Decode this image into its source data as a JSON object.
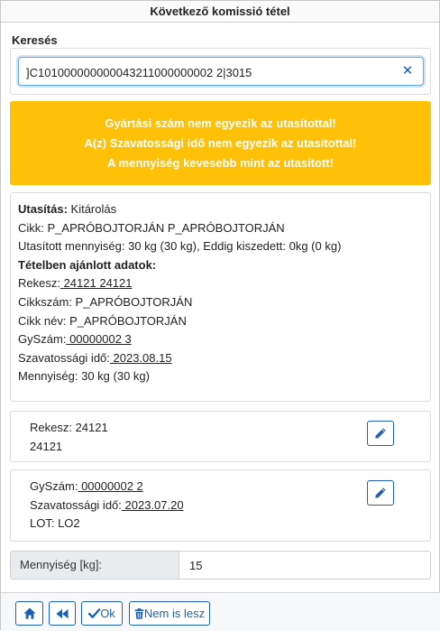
{
  "window": {
    "title": "Következő komissió tétel"
  },
  "search": {
    "label": "Keresés",
    "value": "]C101000000000043211000000002 2|3015",
    "clear_icon": "close-icon"
  },
  "alert": {
    "color": "#ffc107",
    "lines": [
      "Gyártási szám nem egyezik az utasítottal!",
      "A(z) Szavatossági idő nem egyezik az utasítottal!",
      "A mennyiség kevesebb mint az utasított!"
    ]
  },
  "instruction": {
    "label": "Utasítás:",
    "value": " Kitárolás",
    "item_line": " Cikk: P_APRÓBOJTORJÁN P_APRÓBOJTORJÁN",
    "qty_line": " Utasított mennyiség: 30 kg (30 kg), Eddig kiszedett: 0kg (0 kg)",
    "recommended_header": "Tételben ajánlott adatok:",
    "rekesz_label": "Rekesz:",
    "rekesz_value": " 24121 24121",
    "cikkszam_line": " Cikkszám: P_APRÓBOJTORJÁN",
    "cikknev_line": " Cikk név: P_APRÓBOJTORJÁN",
    "gyszam_label": "GySzám:",
    "gyszam_value": " 00000002 3",
    "szav_label": "Szavatossági idő:",
    "szav_value": " 2023.08.15",
    "mennyiseg_line": " Mennyiség: 30 kg (30 kg)"
  },
  "rekesz_card": {
    "line1": "Rekesz: 24121",
    "line2": "24121",
    "edit_icon": "pencil-icon"
  },
  "lot_card": {
    "gyszam_label": "GySzám:",
    "gyszam_value": " 00000002 2",
    "szav_label": "Szavatossági idő:",
    "szav_value": " 2023.07.20",
    "lot_line": "LOT: LO2",
    "edit_icon": "pencil-icon"
  },
  "quantity": {
    "label": "Mennyiség [kg]:",
    "value": "15"
  },
  "footer": {
    "home_icon": "home-icon",
    "back_icon": "backward-icon",
    "ok_label": "Ok",
    "ok_icon": "check-icon",
    "skip_label": "Nem is lesz",
    "skip_icon": "trash-icon",
    "accent": "#1f5fb1"
  }
}
